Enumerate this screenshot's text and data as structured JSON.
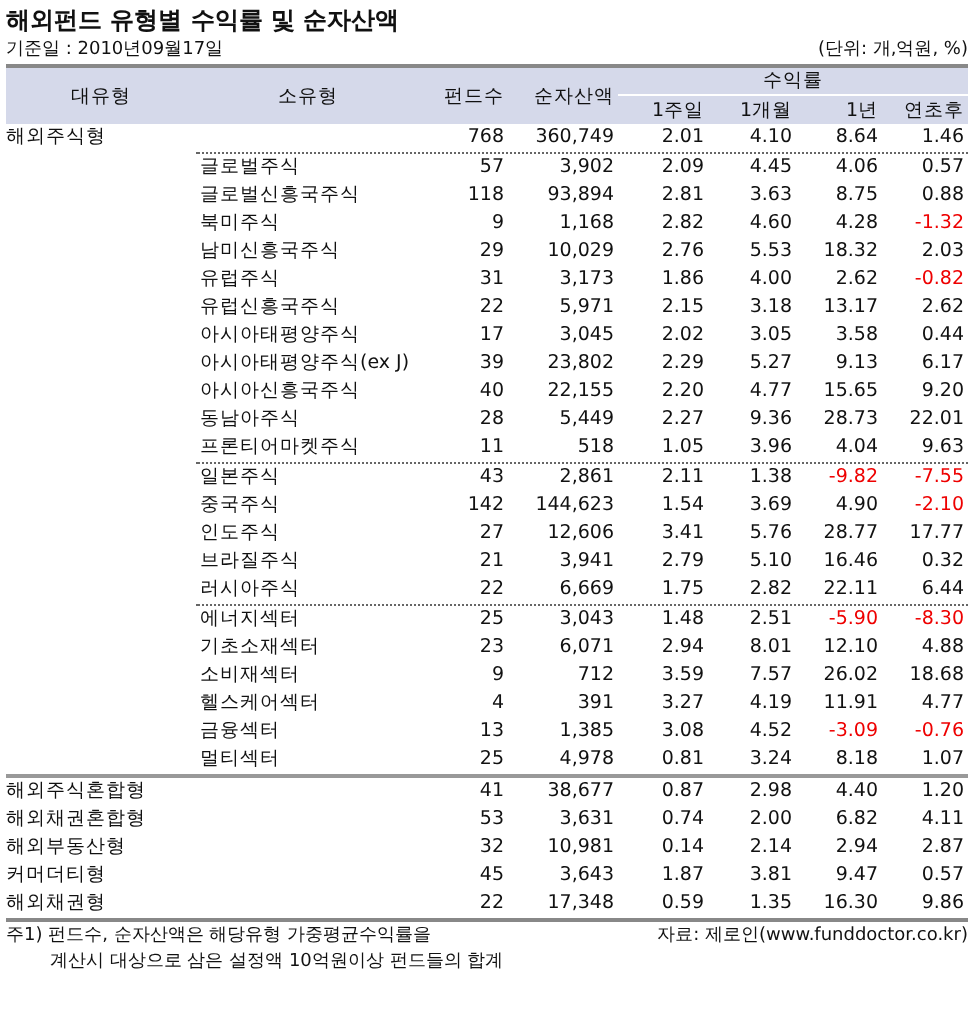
{
  "title": "해외펀드 유형별 수익률 및 순자산액",
  "date": "기준일 : 2010년09월17일",
  "unit": "(단위: 개,억원, %)",
  "headers": {
    "major": "대유형",
    "minor": "소유형",
    "count": "펀드수",
    "assets": "순자산액",
    "returns": "수익률",
    "periods": [
      "1주일",
      "1개월",
      "1년",
      "연초후"
    ]
  },
  "main": {
    "name": "해외주식형",
    "values": [
      "768",
      "360,749",
      "2.01",
      "4.10",
      "8.64",
      "1.46"
    ],
    "groups": [
      [
        {
          "name": "글로벌주식",
          "values": [
            "57",
            "3,902",
            "2.09",
            "4.45",
            "4.06",
            "0.57"
          ]
        },
        {
          "name": "글로벌신흥국주식",
          "values": [
            "118",
            "93,894",
            "2.81",
            "3.63",
            "8.75",
            "0.88"
          ]
        },
        {
          "name": "북미주식",
          "values": [
            "9",
            "1,168",
            "2.82",
            "4.60",
            "4.28",
            {
              "text": "-1.32",
              "negative": true
            }
          ]
        },
        {
          "name": "남미신흥국주식",
          "values": [
            "29",
            "10,029",
            "2.76",
            "5.53",
            "18.32",
            "2.03"
          ]
        },
        {
          "name": "유럽주식",
          "values": [
            "31",
            "3,173",
            "1.86",
            "4.00",
            "2.62",
            {
              "text": "-0.82",
              "negative": true
            }
          ]
        },
        {
          "name": "유럽신흥국주식",
          "values": [
            "22",
            "5,971",
            "2.15",
            "3.18",
            "13.17",
            "2.62"
          ]
        },
        {
          "name": "아시아태평양주식",
          "values": [
            "17",
            "3,045",
            "2.02",
            "3.05",
            "3.58",
            "0.44"
          ]
        },
        {
          "name": "아시아태평양주식(ex J)",
          "values": [
            "39",
            "23,802",
            "2.29",
            "5.27",
            "9.13",
            "6.17"
          ]
        },
        {
          "name": "아시아신흥국주식",
          "values": [
            "40",
            "22,155",
            "2.20",
            "4.77",
            "15.65",
            "9.20"
          ]
        },
        {
          "name": "동남아주식",
          "values": [
            "28",
            "5,449",
            "2.27",
            "9.36",
            "28.73",
            "22.01"
          ]
        },
        {
          "name": "프론티어마켓주식",
          "values": [
            "11",
            "518",
            "1.05",
            "3.96",
            "4.04",
            "9.63"
          ]
        }
      ],
      [
        {
          "name": "일본주식",
          "values": [
            "43",
            "2,861",
            "2.11",
            "1.38",
            {
              "text": "-9.82",
              "negative": true
            },
            {
              "text": "-7.55",
              "negative": true
            }
          ]
        },
        {
          "name": "중국주식",
          "values": [
            "142",
            "144,623",
            "1.54",
            "3.69",
            "4.90",
            {
              "text": "-2.10",
              "negative": true
            }
          ]
        },
        {
          "name": "인도주식",
          "values": [
            "27",
            "12,606",
            "3.41",
            "5.76",
            "28.77",
            "17.77"
          ]
        },
        {
          "name": "브라질주식",
          "values": [
            "21",
            "3,941",
            "2.79",
            "5.10",
            "16.46",
            "0.32"
          ]
        },
        {
          "name": "러시아주식",
          "values": [
            "22",
            "6,669",
            "1.75",
            "2.82",
            "22.11",
            "6.44"
          ]
        }
      ],
      [
        {
          "name": "에너지섹터",
          "values": [
            "25",
            "3,043",
            "1.48",
            "2.51",
            {
              "text": "-5.90",
              "negative": true
            },
            {
              "text": "-8.30",
              "negative": true
            }
          ]
        },
        {
          "name": "기초소재섹터",
          "values": [
            "23",
            "6,071",
            "2.94",
            "8.01",
            "12.10",
            "4.88"
          ]
        },
        {
          "name": "소비재섹터",
          "values": [
            "9",
            "712",
            "3.59",
            "7.57",
            "26.02",
            "18.68"
          ]
        },
        {
          "name": "헬스케어섹터",
          "values": [
            "4",
            "391",
            "3.27",
            "4.19",
            "11.91",
            "4.77"
          ]
        },
        {
          "name": "금융섹터",
          "values": [
            "13",
            "1,385",
            "3.08",
            "4.52",
            {
              "text": "-3.09",
              "negative": true
            },
            {
              "text": "-0.76",
              "negative": true
            }
          ]
        },
        {
          "name": "멀티섹터",
          "values": [
            "25",
            "4,978",
            "0.81",
            "3.24",
            "8.18",
            "1.07"
          ]
        }
      ]
    ]
  },
  "others": [
    {
      "name": "해외주식혼합형",
      "values": [
        "41",
        "38,677",
        "0.87",
        "2.98",
        "4.40",
        "1.20"
      ]
    },
    {
      "name": "해외채권혼합형",
      "values": [
        "53",
        "3,631",
        "0.74",
        "2.00",
        "6.82",
        "4.11"
      ]
    },
    {
      "name": "해외부동산형",
      "values": [
        "32",
        "10,981",
        "0.14",
        "2.14",
        "2.94",
        "2.87"
      ]
    },
    {
      "name": "커머더티형",
      "values": [
        "45",
        "3,643",
        "1.87",
        "3.81",
        "9.47",
        "0.57"
      ]
    },
    {
      "name": "해외채권형",
      "values": [
        "22",
        "17,348",
        "0.59",
        "1.35",
        "16.30",
        "9.86"
      ]
    }
  ],
  "note": [
    "주1) 펀드수, 순자산액은 해당유형 가중평균수익률을",
    "계산시 대상으로 삼은 설정액 10억원이상 펀드들의 합계"
  ],
  "source": "자료: 제로인(www.funddoctor.co.kr)"
}
